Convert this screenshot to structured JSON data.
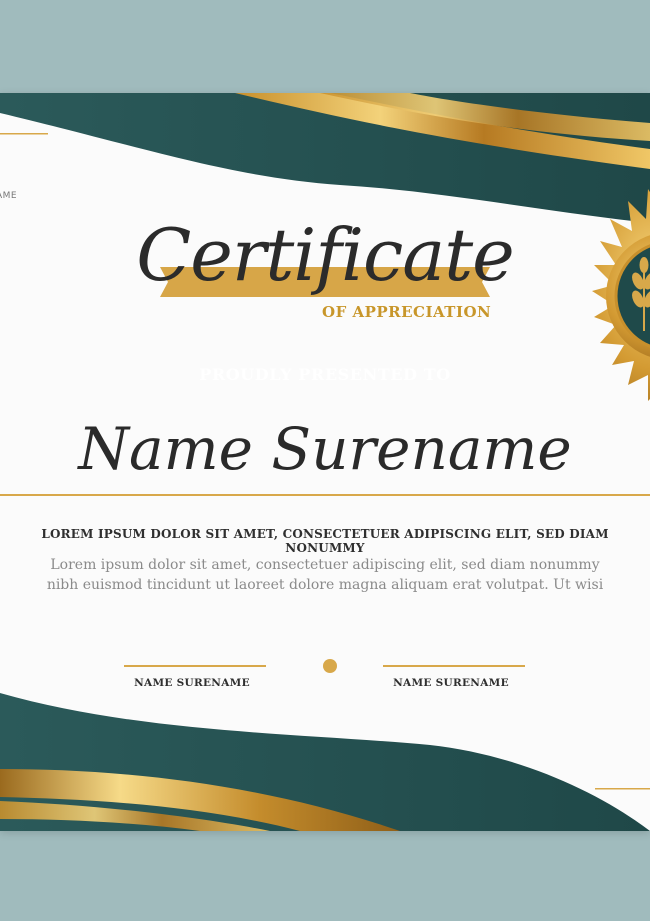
{
  "certificate": {
    "cut_label": "AME",
    "title": "Certificate",
    "subtitle": "OF APPRECIATION",
    "banner": "PROUDLY PRESENTED TO",
    "recipient": "Name Surename",
    "heading": "LOREM IPSUM DOLOR SIT AMET, CONSECTETUER ADIPISCING ELIT, SED DIAM NONUMMY",
    "body_line1": "Lorem ipsum dolor sit amet, consectetuer adipiscing elit, sed diam nonummy",
    "body_line2": "nibh euismod tincidunt ut laoreet dolore magna aliquam erat volutpat. Ut wisi",
    "signature_left": "NAME SURENAME",
    "signature_right": "NAME SURENAME"
  },
  "colors": {
    "background": "#a0bbbd",
    "paper": "#fbfbfb",
    "teal": "#2f5d5c",
    "gold": "#d8a84a",
    "gold_dark": "#b9862c"
  }
}
